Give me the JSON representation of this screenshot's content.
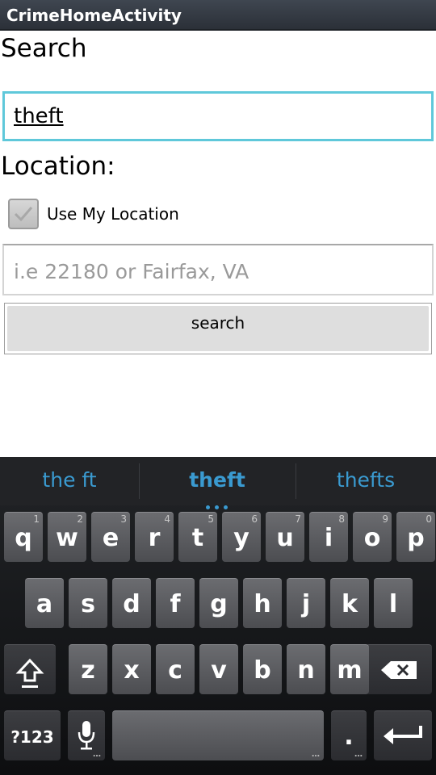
{
  "app": {
    "title": "CrimeHomeActivity"
  },
  "form": {
    "search_heading": "Search",
    "query_value": "theft",
    "location_heading": "Location:",
    "use_location_label": "Use My Location",
    "use_location_checked": true,
    "location_placeholder": "i.e 22180 or Fairfax, VA",
    "search_button": "search"
  },
  "keyboard": {
    "suggestions": [
      "the ft",
      "theft",
      "thefts"
    ],
    "row1": [
      {
        "key": "q",
        "num": "1"
      },
      {
        "key": "w",
        "num": "2"
      },
      {
        "key": "e",
        "num": "3"
      },
      {
        "key": "r",
        "num": "4"
      },
      {
        "key": "t",
        "num": "5"
      },
      {
        "key": "y",
        "num": "6"
      },
      {
        "key": "u",
        "num": "7"
      },
      {
        "key": "i",
        "num": "8"
      },
      {
        "key": "o",
        "num": "9"
      },
      {
        "key": "p",
        "num": "0"
      }
    ],
    "row2": [
      "a",
      "s",
      "d",
      "f",
      "g",
      "h",
      "j",
      "k",
      "l"
    ],
    "row3": [
      "z",
      "x",
      "c",
      "v",
      "b",
      "n",
      "m"
    ],
    "symbols_label": "?123",
    "period_label": ".",
    "icons": {
      "shift": "shift-icon",
      "backspace": "backspace-icon",
      "mic": "microphone-icon",
      "enter": "enter-icon"
    }
  },
  "colors": {
    "accent": "#5fc8da",
    "suggestion": "#3a9ad0"
  }
}
